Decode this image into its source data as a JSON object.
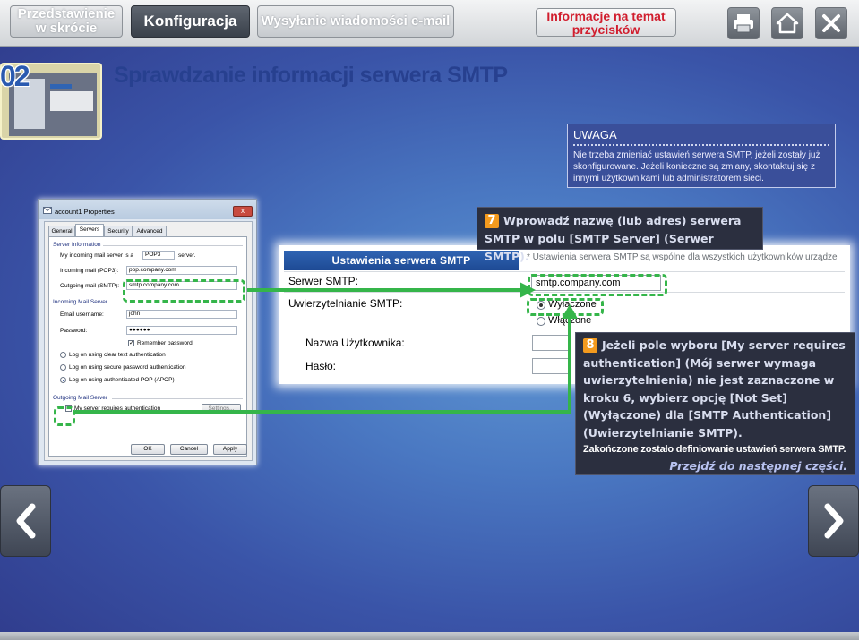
{
  "header": {
    "tabs": [
      {
        "label": "Przedstawienie w skrócie"
      },
      {
        "label": "Konfiguracja"
      },
      {
        "label": "Wysyłanie wiadomości e-mail"
      }
    ],
    "info_button": "Informacje na temat przycisków",
    "icons": [
      "print-icon",
      "home-icon",
      "close-icon"
    ]
  },
  "step": {
    "number": "02",
    "title": "Sprawdzanie informacji serwera SMTP"
  },
  "note": {
    "title": "UWAGA",
    "text": "Nie trzeba zmieniać ustawień serwera SMTP, jeżeli zostały już skonfigurowane. Jeżeli konieczne są zmiany, skontaktuj się z innymi użytkownikami lub administratorem sieci."
  },
  "dialog": {
    "title": "account1 Properties",
    "close": "x",
    "tabs": [
      "General",
      "Servers",
      "Security",
      "Advanced"
    ],
    "server_info": {
      "group": "Server Information",
      "incoming_type_label": "My incoming mail server is a",
      "incoming_type_value": "POP3",
      "incoming_type_suffix": "server.",
      "incoming_label": "Incoming mail (POP3):",
      "incoming_value": "pop.company.com",
      "outgoing_label": "Outgoing mail (SMTP):",
      "outgoing_value": "smtp.company.com"
    },
    "incoming": {
      "group": "Incoming Mail Server",
      "email_label": "Email username:",
      "email_value": "john",
      "password_label": "Password:",
      "password_value": "●●●●●●",
      "remember": "Remember password",
      "opt1": "Log on using clear text authentication",
      "opt2": "Log on using secure password authentication",
      "opt3": "Log on using authenticated POP (APOP)"
    },
    "outgoing": {
      "group": "Outgoing Mail Server",
      "requires_auth": "My server requires authentication",
      "settings": "Settings..."
    },
    "buttons": {
      "ok": "OK",
      "cancel": "Cancel",
      "apply": "Apply"
    }
  },
  "smtp": {
    "header": "Ustawienia serwera SMTP",
    "note": "* Ustawienia serwera SMTP są wspólne dla wszystkich użytkowników urządze",
    "server_label": "Serwer SMTP:",
    "server_value": "smtp.company.com",
    "auth_label": "Uwierzytelnianie SMTP:",
    "auth_off": "Wyłączone",
    "auth_on": "Włączone",
    "user_label": "Nazwa Użytkownika:",
    "password_label": "Hasło:"
  },
  "callout7": {
    "number": "7",
    "text": "Wprowadź nazwę (lub adres) serwera SMTP w polu [SMTP Server] (Serwer SMTP)."
  },
  "callout8": {
    "number": "8",
    "text": "Jeżeli pole wyboru [My server requires authentication] (Mój serwer wymaga uwierzytelnienia) nie jest zaznaczone w kroku 6, wybierz opcję [Not Set] (Wyłączone) dla [SMTP Authentication] (Uwierzytelnianie SMTP).",
    "done": "Zakończone zostało definiowanie ustawień serwera SMTP.",
    "next": "Przejdź do następnej części."
  },
  "nav": {
    "prev": "prev-arrow-icon",
    "next": "next-arrow-icon"
  },
  "colors": {
    "accent_green": "#35b54a",
    "badge_orange": "#f39a1e",
    "title_blue": "#27408f",
    "info_red": "#d11e2e"
  }
}
